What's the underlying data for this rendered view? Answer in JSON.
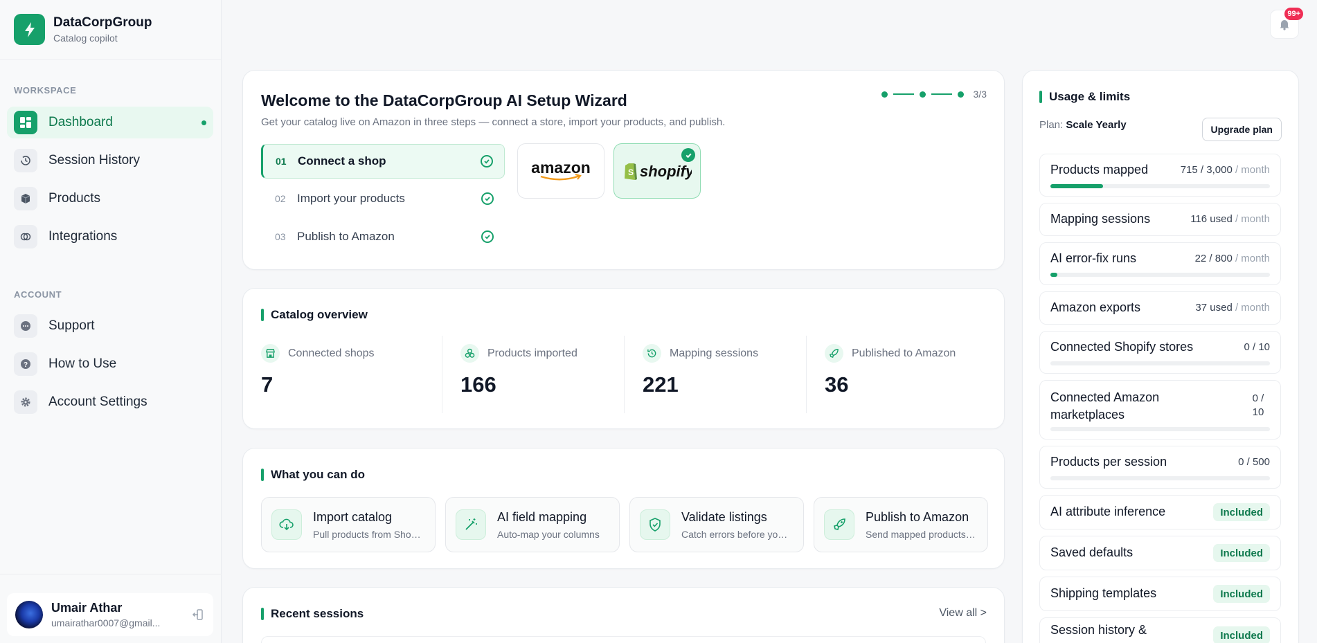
{
  "brand": {
    "title": "DataCorpGroup",
    "subtitle": "Catalog copilot",
    "logo_icon": "bolt-icon",
    "accent_color": "#16a06a"
  },
  "sidebar": {
    "workspace_label": "WORKSPACE",
    "workspace_items": [
      {
        "label": "Dashboard",
        "icon": "dashboard-icon",
        "active": true
      },
      {
        "label": "Session History",
        "icon": "history-icon"
      },
      {
        "label": "Products",
        "icon": "cube-icon"
      },
      {
        "label": "Integrations",
        "icon": "link-icon"
      }
    ],
    "account_label": "ACCOUNT",
    "account_items": [
      {
        "label": "Support",
        "icon": "chat-icon"
      },
      {
        "label": "How to Use",
        "icon": "help-icon"
      },
      {
        "label": "Account Settings",
        "icon": "gear-icon"
      }
    ],
    "user": {
      "name": "Umair Athar",
      "email": "umairathar0007@gmail..."
    }
  },
  "header": {
    "notification_count": "99+"
  },
  "wizard": {
    "title": "Welcome to the DataCorpGroup AI Setup Wizard",
    "subtitle": "Get your catalog live on Amazon in three steps — connect a store, import your products, and publish.",
    "progress": "3/3",
    "steps": [
      {
        "num": "01",
        "label": "Connect a shop",
        "active": true
      },
      {
        "num": "02",
        "label": "Import your products"
      },
      {
        "num": "03",
        "label": "Publish to Amazon"
      }
    ],
    "platforms": [
      {
        "name": "amazon"
      },
      {
        "name": "shopify",
        "selected": true
      }
    ]
  },
  "overview": {
    "heading": "Catalog overview",
    "stats": [
      {
        "label": "Connected shops",
        "value": "7",
        "icon": "store-icon"
      },
      {
        "label": "Products imported",
        "value": "166",
        "icon": "boxes-icon"
      },
      {
        "label": "Mapping sessions",
        "value": "221",
        "icon": "history-icon"
      },
      {
        "label": "Published to Amazon",
        "value": "36",
        "icon": "rocket-icon"
      }
    ]
  },
  "actions": {
    "heading": "What you can do",
    "items": [
      {
        "title": "Import catalog",
        "subtitle": "Pull products from Shopify",
        "icon": "cloud-download-icon"
      },
      {
        "title": "AI field mapping",
        "subtitle": "Auto-map your columns",
        "icon": "magic-wand-icon"
      },
      {
        "title": "Validate listings",
        "subtitle": "Catch errors before you publish",
        "icon": "shield-check-icon"
      },
      {
        "title": "Publish to Amazon",
        "subtitle": "Send mapped products to Amazon",
        "icon": "rocket-icon"
      }
    ]
  },
  "recent": {
    "heading": "Recent sessions",
    "view_all": "View all >"
  },
  "usage": {
    "heading": "Usage & limits",
    "plan_label": "Plan:",
    "plan_name": "Scale Yearly",
    "upgrade": "Upgrade plan",
    "limits": [
      {
        "name": "Products mapped",
        "value": "715 / 3,000",
        "period": "/ month",
        "fill": 0.24
      },
      {
        "name": "Mapping sessions",
        "value": "116 used",
        "period": "/ month"
      },
      {
        "name": "AI error-fix runs",
        "value": "22 / 800",
        "period": "/ month",
        "fill": 0.03
      },
      {
        "name": "Amazon exports",
        "value": "37 used",
        "period": "/ month"
      },
      {
        "name": "Connected Shopify stores",
        "value": "0 / 10",
        "fill": 0
      },
      {
        "name": "Connected Amazon marketplaces",
        "value": "0 / 10",
        "fill": 0
      },
      {
        "name": "Products per session",
        "value": "0 / 500",
        "fill": 0
      },
      {
        "name": "AI attribute inference",
        "badge": "Included"
      },
      {
        "name": "Saved defaults",
        "badge": "Included"
      },
      {
        "name": "Shipping templates",
        "badge": "Included"
      },
      {
        "name": "Session history &",
        "badge": "Included"
      }
    ]
  }
}
